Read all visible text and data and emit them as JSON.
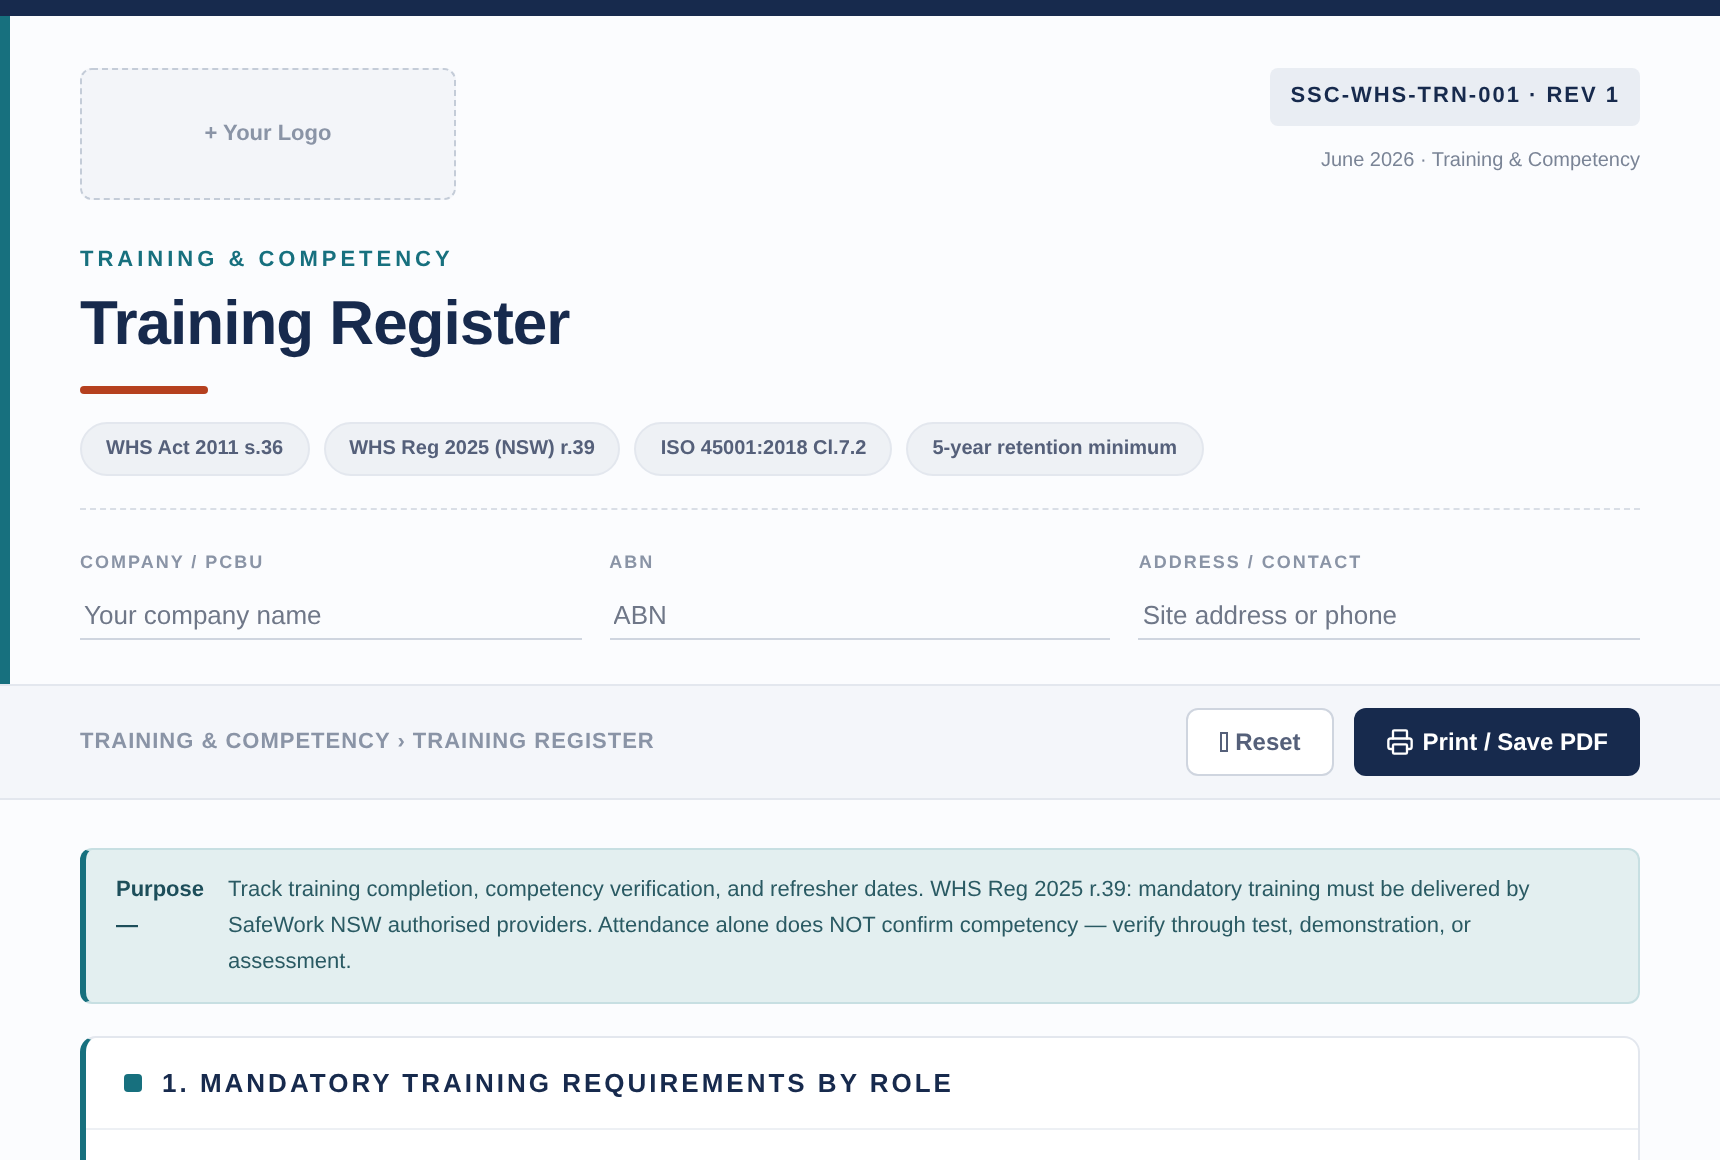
{
  "logo_placeholder": "+ Your Logo",
  "doc_code": "SSC-WHS-TRN-001 · REV 1",
  "doc_meta": "June 2026 · Training & Competency",
  "eyebrow": "TRAINING & COMPETENCY",
  "title": "Training Register",
  "tags": [
    "WHS Act 2011 s.36",
    "WHS Reg 2025 (NSW) r.39",
    "ISO 45001:2018 Cl.7.2",
    "5-year retention minimum"
  ],
  "fields": [
    {
      "label": "COMPANY / PCBU",
      "placeholder": "Your company name"
    },
    {
      "label": "ABN",
      "placeholder": "ABN"
    },
    {
      "label": "ADDRESS / CONTACT",
      "placeholder": "Site address or phone"
    }
  ],
  "breadcrumb": "TRAINING & COMPETENCY › TRAINING REGISTER",
  "buttons": [
    {
      "kind": "secondary",
      "label": "Reset"
    },
    {
      "kind": "primary",
      "label": "Print / Save PDF"
    }
  ],
  "purpose": {
    "label": "Purpose —",
    "text": "Track training completion, competency verification, and refresher dates. WHS Reg 2025 r.39: mandatory training must be delivered by SafeWork NSW authorised providers. Attendance alone does NOT confirm competency — verify through test, demonstration, or assessment."
  },
  "section": {
    "title": "1. MANDATORY TRAINING REQUIREMENTS BY ROLE"
  }
}
